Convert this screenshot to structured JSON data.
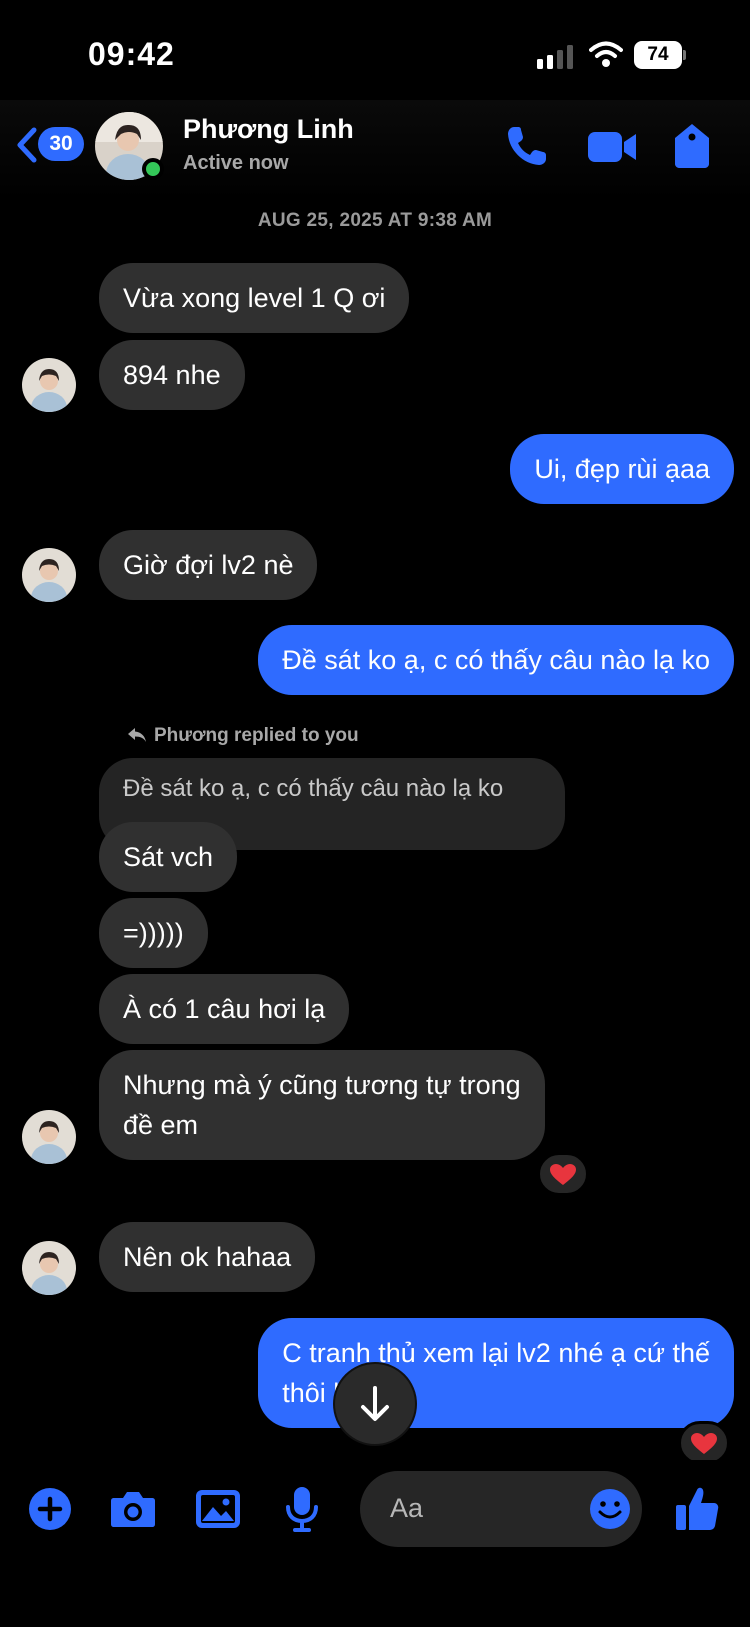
{
  "status_bar": {
    "time": "09:42",
    "battery": "74"
  },
  "header": {
    "back_count": "30",
    "contact_name": "Phương Linh",
    "contact_status": "Active now"
  },
  "timestamp": "AUG 25, 2025 AT 9:38 AM",
  "messages": [
    {
      "from": "them",
      "text": "Vừa xong level 1 Q ơi"
    },
    {
      "from": "them",
      "text": "894 nhe"
    },
    {
      "from": "me",
      "text": "Ui, đẹp rùi ạaa"
    },
    {
      "from": "them",
      "text": "Giờ đợi lv2 nè"
    },
    {
      "from": "me",
      "text": "Đề sát ko ạ, c có thấy câu nào lạ ko"
    },
    {
      "from": "them",
      "text": "Sát vch"
    },
    {
      "from": "them",
      "text": "=)))))"
    },
    {
      "from": "them",
      "text": "À có 1 câu hơi lạ"
    },
    {
      "from": "them",
      "text_line1": "Nhưng mà ý cũng tương tự trong",
      "text_line2": "đề em",
      "reaction": "heart"
    },
    {
      "from": "them",
      "text": "Nên ok hahaa"
    },
    {
      "from": "me",
      "text_line1": "C tranh thủ xem lại lv2 nhé ạ cứ thế",
      "text_line2": "thôi hẹ hẹ",
      "reaction": "heart"
    }
  ],
  "reply": {
    "label": "Phương replied to you",
    "quoted_text": "Đề sát ko ạ, c có thấy câu nào lạ ko"
  },
  "composer": {
    "placeholder": "Aa"
  },
  "colors": {
    "accent": "#2f6bff",
    "incoming_bubble": "#303030",
    "background": "#000000",
    "online": "#34c759"
  }
}
